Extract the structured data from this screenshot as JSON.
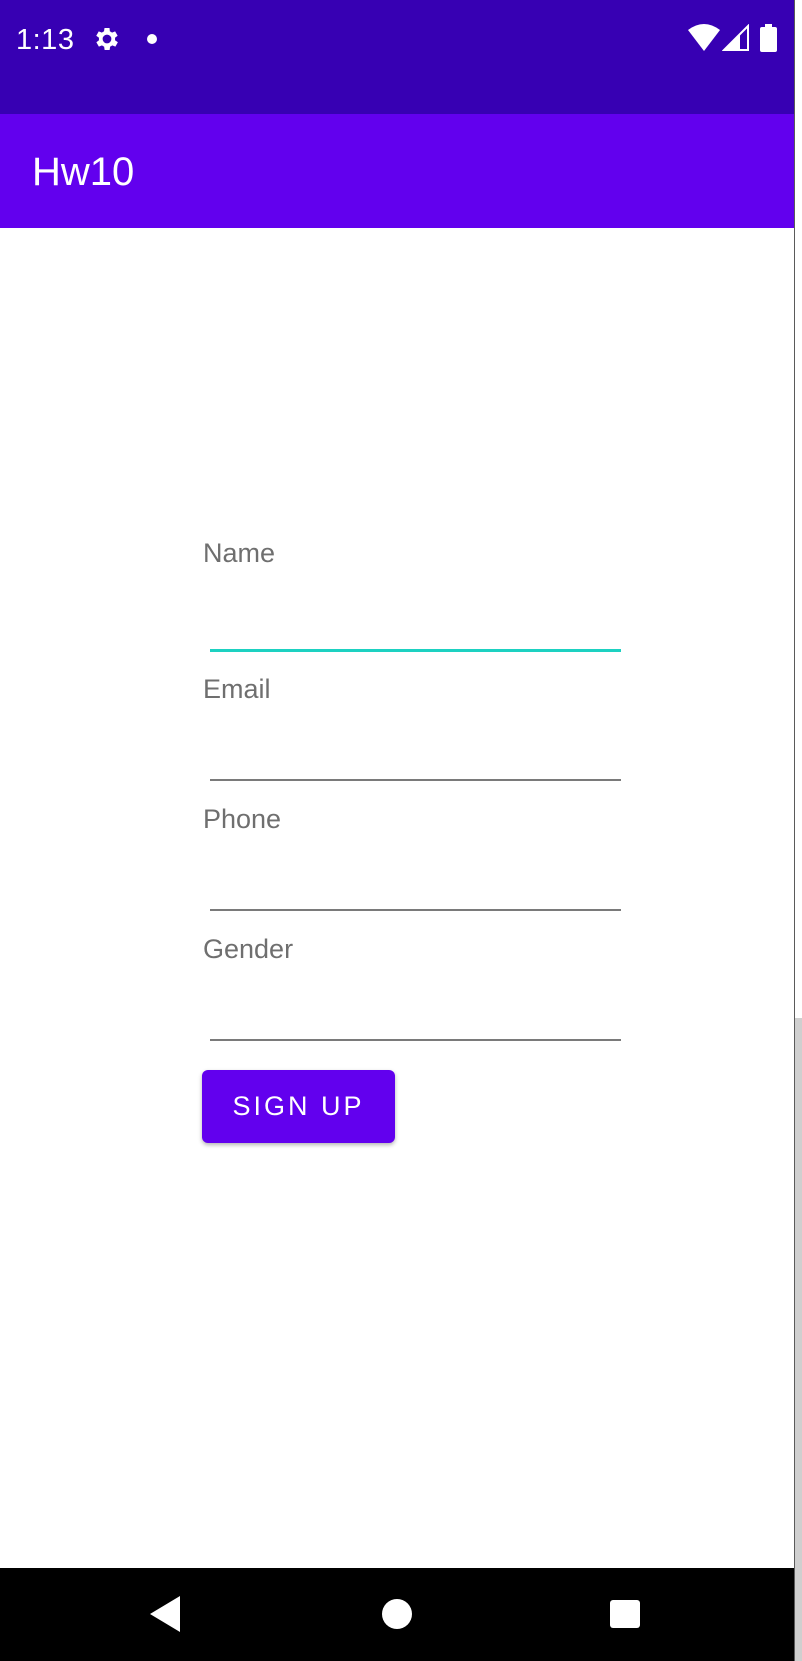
{
  "status_bar": {
    "time": "1:13",
    "icons": [
      "gear-icon",
      "notification-dot-icon",
      "wifi-icon",
      "cell-signal-icon",
      "battery-icon"
    ],
    "background_color": "#3700b3"
  },
  "app_bar": {
    "title": "Hw10",
    "background_color": "#6200ee"
  },
  "form": {
    "fields": [
      {
        "label": "Name",
        "value": "",
        "focused": true
      },
      {
        "label": "Email",
        "value": "",
        "focused": false
      },
      {
        "label": "Phone",
        "value": "",
        "focused": false
      },
      {
        "label": "Gender",
        "value": "",
        "focused": false
      }
    ],
    "focus_color": "#1dd1c1",
    "submit_label": "SIGN UP",
    "submit_color": "#6200ee"
  },
  "nav_bar": {
    "icons": [
      "back-icon",
      "home-icon",
      "recents-icon"
    ]
  }
}
